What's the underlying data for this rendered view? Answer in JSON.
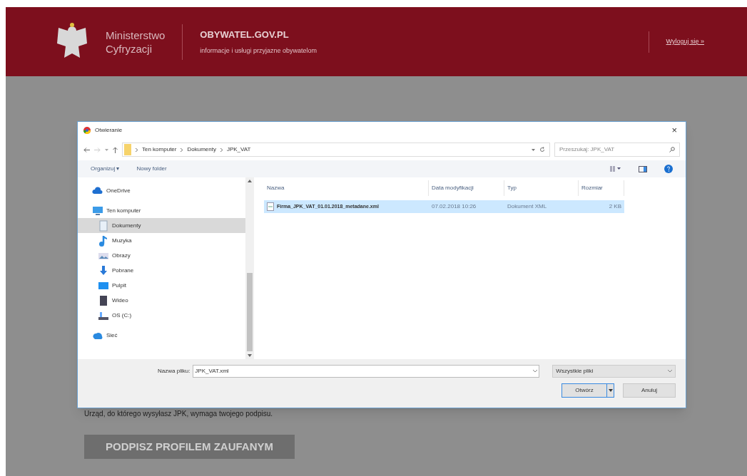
{
  "header": {
    "ministry": [
      "Ministerstwo",
      "Cyfryzacji"
    ],
    "site": "OBYWATEL.GOV.PL",
    "tagline": "informacje i usługi przyjazne obywatelom",
    "logout": "Wyloguj się »"
  },
  "page": {
    "note": "Urząd, do którego wysyłasz JPK, wymaga twojego podpisu.",
    "sign_button": {
      "label": "PODPISZ PROFILEM ZAUFANYM",
      "disabled": true
    }
  },
  "dialog": {
    "title": "Otwieranie",
    "close": "×",
    "path": [
      "Ten komputer",
      "Dokumenty",
      "JPK_VAT"
    ],
    "search": {
      "placeholder": "Przeszukaj: JPK_VAT"
    },
    "toolbar": [
      "Organizuj ▾",
      "Nowy folder"
    ],
    "sidebar": [
      {
        "label": "OneDrive",
        "kind": "cloud",
        "selected": false
      },
      {
        "label": "Ten komputer",
        "kind": "pc",
        "selected": false,
        "children": [
          {
            "label": "Dokumenty",
            "kind": "docs",
            "selected": true
          },
          {
            "label": "Muzyka",
            "kind": "music",
            "selected": false
          },
          {
            "label": "Obrazy",
            "kind": "pictures",
            "selected": false
          },
          {
            "label": "Pobrane",
            "kind": "download",
            "selected": false
          },
          {
            "label": "Pulpit",
            "kind": "desktop",
            "selected": false
          },
          {
            "label": "Wideo",
            "kind": "video",
            "selected": false
          },
          {
            "label": "OS (C:)",
            "kind": "drive",
            "selected": false
          }
        ]
      },
      {
        "label": "Sieć",
        "kind": "network",
        "selected": false
      }
    ],
    "columns": [
      "Nazwa",
      "Data modyfikacji",
      "Typ",
      "Rozmiar"
    ],
    "files": [
      {
        "name": "Firma_JPK_VAT_01.01.2018_metadane.xml",
        "date": "07.02.2018 10:26",
        "type": "Dokument XML",
        "size": "2 KB",
        "selected": true
      }
    ],
    "filename_label": "Nazwa pliku:",
    "filename": "JPK_VAT.xml",
    "filter": "Wszystkie pliki",
    "open": "Otwórz",
    "cancel": "Anuluj"
  }
}
